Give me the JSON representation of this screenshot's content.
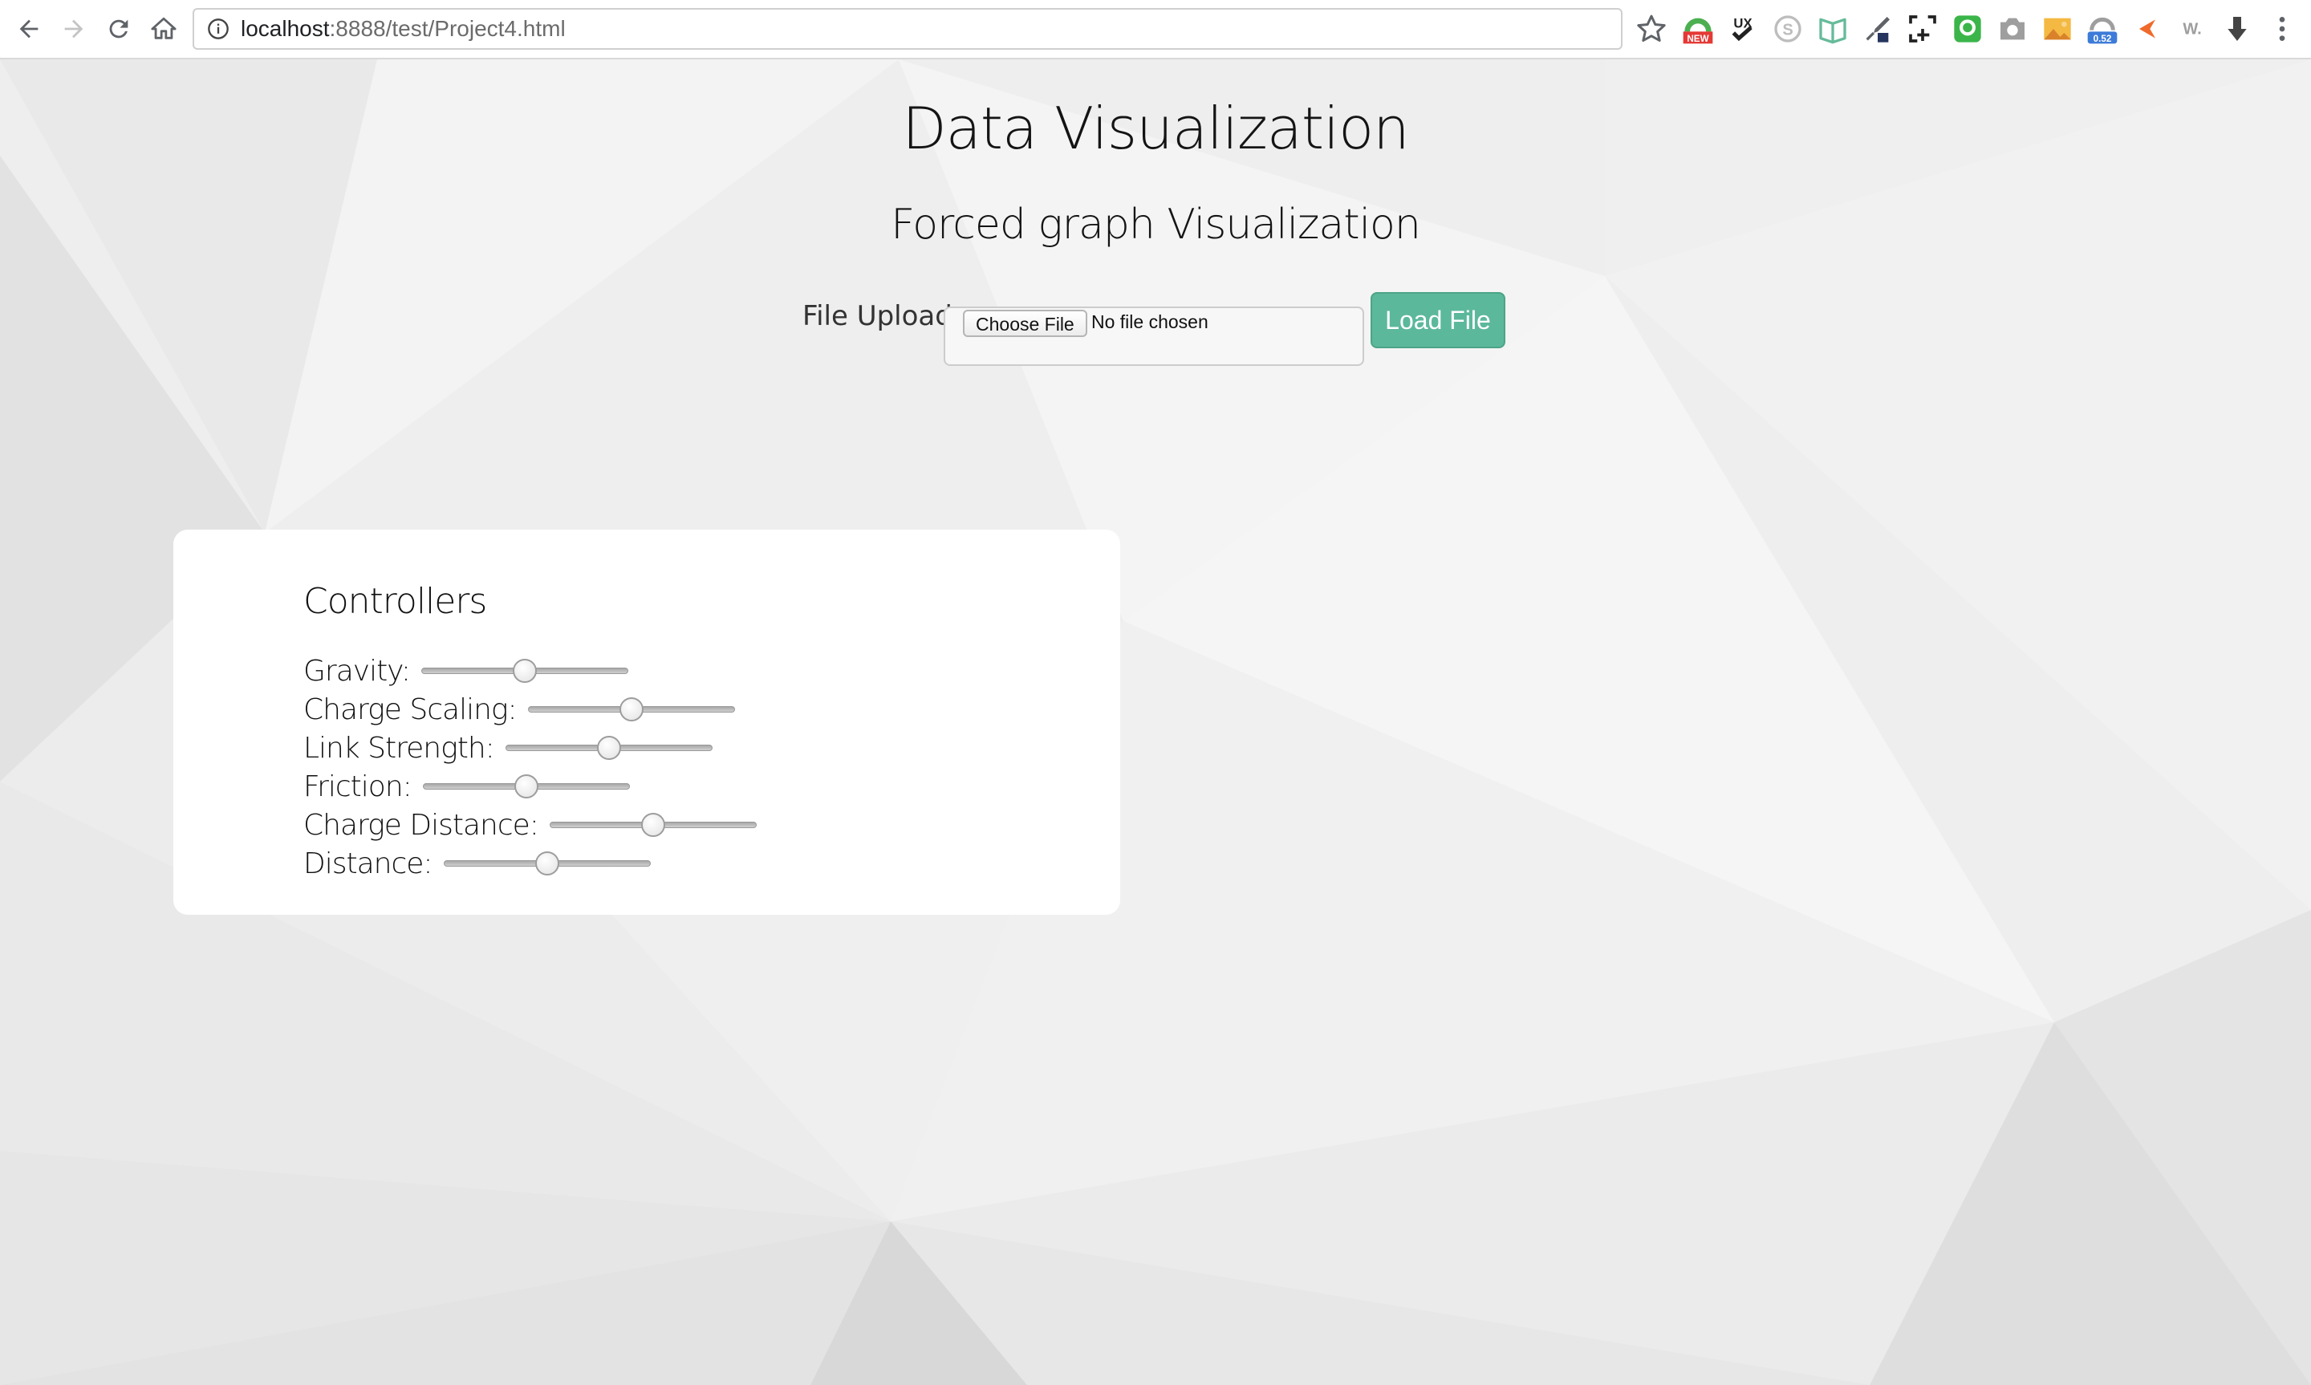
{
  "browser": {
    "url_host": "localhost",
    "url_rest": ":8888/test/Project4.html",
    "extensions": [
      {
        "icon": "bookmark-star-icon"
      },
      {
        "icon": "extension-new-badge-icon",
        "badge": "NEW",
        "color": "#4caf50"
      },
      {
        "icon": "ux-check-icon",
        "label": "UX"
      },
      {
        "icon": "skype-icon"
      },
      {
        "icon": "book-icon"
      },
      {
        "icon": "eyedropper-icon"
      },
      {
        "icon": "screenshot-crop-icon"
      },
      {
        "icon": "green-chat-icon",
        "color": "#3bb54a"
      },
      {
        "icon": "camera-icon"
      },
      {
        "icon": "image-icon"
      },
      {
        "icon": "speed-gauge-icon",
        "badge": "0.52",
        "color": "#3d7bd9"
      },
      {
        "icon": "orange-arrow-icon",
        "color": "#f06a2b"
      },
      {
        "icon": "w-dot-icon",
        "label": "W."
      },
      {
        "icon": "download-arrow-icon"
      },
      {
        "icon": "kebab-menu-icon"
      }
    ]
  },
  "page": {
    "title": "Data Visualization",
    "subtitle": "Forced graph Visualization",
    "upload": {
      "label": "File Upload:",
      "choose_button": "Choose File",
      "status": "No file chosen",
      "load_button": "Load File",
      "load_button_color": "#5cb89b"
    },
    "controllers": {
      "title": "Controllers",
      "sliders": [
        {
          "label": "Gravity:",
          "value": 0.5
        },
        {
          "label": "Charge Scaling:",
          "value": 0.5
        },
        {
          "label": "Link Strength:",
          "value": 0.5
        },
        {
          "label": "Friction:",
          "value": 0.5
        },
        {
          "label": "Charge Distance:",
          "value": 0.5
        },
        {
          "label": "Distance:",
          "value": 0.5
        }
      ]
    }
  }
}
